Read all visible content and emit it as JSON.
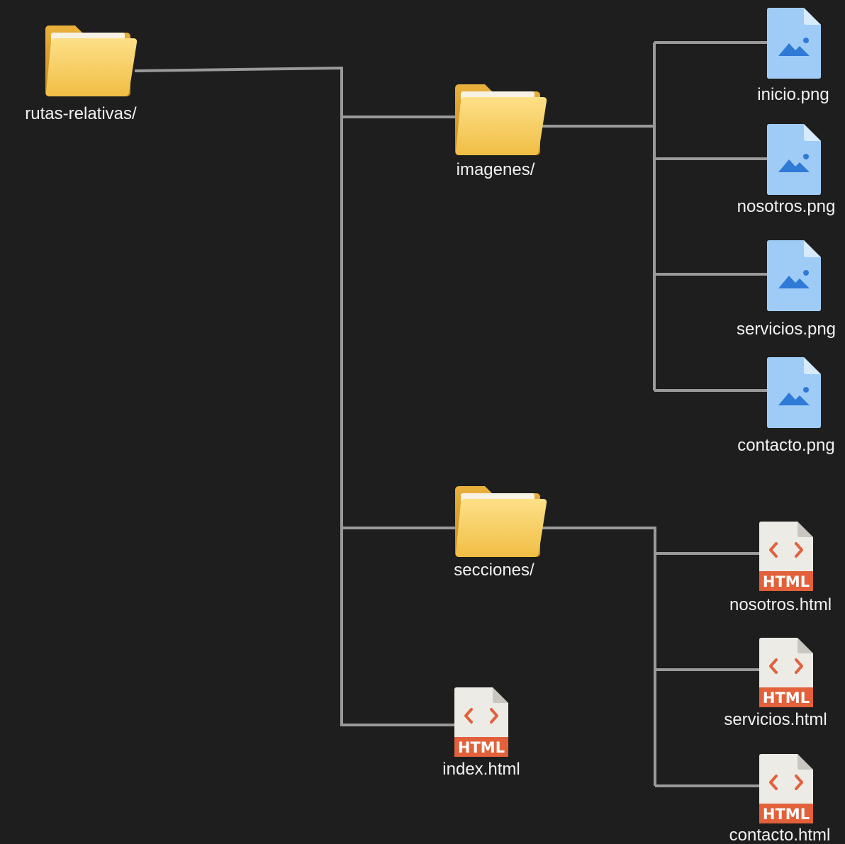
{
  "diagram": {
    "root": {
      "label": "rutas-relativas/",
      "icon": "folder-icon"
    },
    "imagenes": {
      "label": "imagenes/",
      "icon": "folder-icon"
    },
    "secciones": {
      "label": "secciones/",
      "icon": "folder-icon"
    },
    "index": {
      "label": "index.html",
      "icon": "html-file-icon",
      "badge": "HTML"
    },
    "images": [
      {
        "label": "inicio.png",
        "icon": "image-file-icon"
      },
      {
        "label": "nosotros.png",
        "icon": "image-file-icon"
      },
      {
        "label": "servicios.png",
        "icon": "image-file-icon"
      },
      {
        "label": "contacto.png",
        "icon": "image-file-icon"
      }
    ],
    "sections": [
      {
        "label": "nosotros.html",
        "icon": "html-file-icon",
        "badge": "HTML"
      },
      {
        "label": "servicios.html",
        "icon": "html-file-icon",
        "badge": "HTML"
      },
      {
        "label": "contacto.html",
        "icon": "html-file-icon",
        "badge": "HTML"
      }
    ],
    "colors": {
      "background": "#1e1e1e",
      "connector": "#9a9a9a",
      "folder": "#f2c44f",
      "image_file": "#9fccf7",
      "image_glyph": "#2f7ad6",
      "html_file": "#ecebe6",
      "html_accent": "#e2613b"
    }
  }
}
